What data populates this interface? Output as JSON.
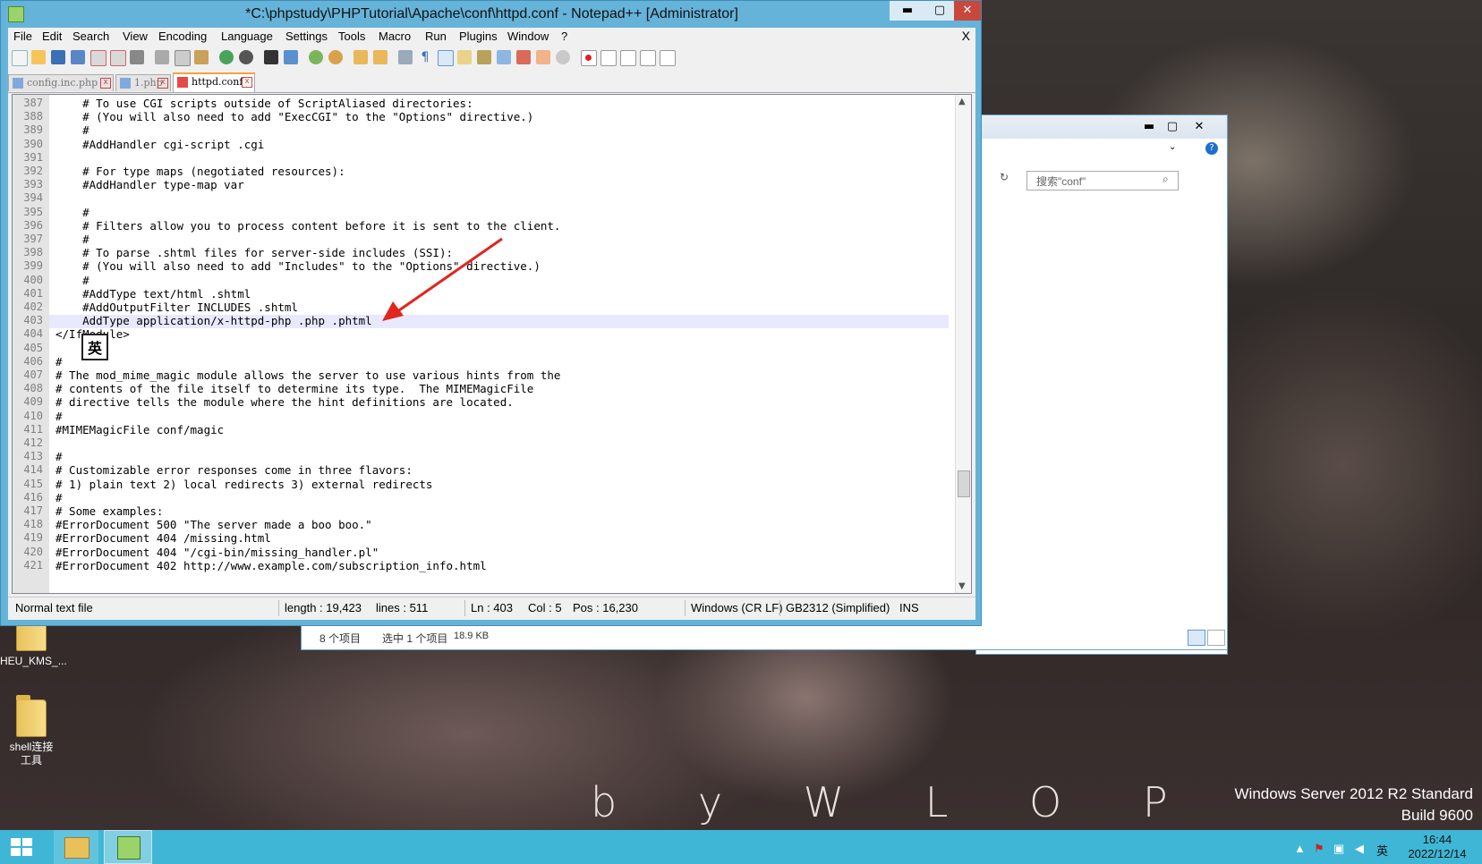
{
  "desktop": {
    "wallpaper_signature": "b y   W L O P",
    "os_version_line1": "Windows Server 2012 R2 Standard",
    "os_version_line2": "Build 9600",
    "icons": [
      {
        "label": "HEU_KMS_..."
      },
      {
        "label": "shell连接工具"
      }
    ]
  },
  "taskbar": {
    "tray_ime": "英",
    "clock_time": "16:44",
    "clock_date": "2022/12/14"
  },
  "explorer": {
    "search_placeholder": "搜索\"conf\"",
    "status_items": "8 个项目",
    "status_selected": "选中 1 个项目",
    "status_size": "18.9 KB"
  },
  "notepad": {
    "title": "*C:\\phpstudy\\PHPTutorial\\Apache\\conf\\httpd.conf - Notepad++ [Administrator]",
    "window_controls": {
      "minimize": "▬",
      "maximize": "▢",
      "close": "✕"
    },
    "menu": [
      "File",
      "Edit",
      "Search",
      "View",
      "Encoding",
      "Language",
      "Settings",
      "Tools",
      "Macro",
      "Run",
      "Plugins",
      "Window",
      "?"
    ],
    "close_doc": "X",
    "tabs": [
      {
        "label": "config.inc.php",
        "active": false
      },
      {
        "label": "1.php",
        "active": false
      },
      {
        "label": "httpd.conf",
        "active": true
      }
    ],
    "lines": [
      {
        "n": "387",
        "text": "    # To use CGI scripts outside of ScriptAliased directories:"
      },
      {
        "n": "388",
        "text": "    # (You will also need to add \"ExecCGI\" to the \"Options\" directive.)"
      },
      {
        "n": "389",
        "text": "    #"
      },
      {
        "n": "390",
        "text": "    #AddHandler cgi-script .cgi"
      },
      {
        "n": "391",
        "text": ""
      },
      {
        "n": "392",
        "text": "    # For type maps (negotiated resources):"
      },
      {
        "n": "393",
        "text": "    #AddHandler type-map var"
      },
      {
        "n": "394",
        "text": ""
      },
      {
        "n": "395",
        "text": "    #"
      },
      {
        "n": "396",
        "text": "    # Filters allow you to process content before it is sent to the client."
      },
      {
        "n": "397",
        "text": "    #"
      },
      {
        "n": "398",
        "text": "    # To parse .shtml files for server-side includes (SSI):"
      },
      {
        "n": "399",
        "text": "    # (You will also need to add \"Includes\" to the \"Options\" directive.)"
      },
      {
        "n": "400",
        "text": "    #"
      },
      {
        "n": "401",
        "text": "    #AddType text/html .shtml"
      },
      {
        "n": "402",
        "text": "    #AddOutputFilter INCLUDES .shtml"
      },
      {
        "n": "403",
        "text": "    AddType application/x-httpd-php .php .phtml"
      },
      {
        "n": "404",
        "text": "</IfModule>"
      },
      {
        "n": "405",
        "text": ""
      },
      {
        "n": "406",
        "text": "#"
      },
      {
        "n": "407",
        "text": "# The mod_mime_magic module allows the server to use various hints from the"
      },
      {
        "n": "408",
        "text": "# contents of the file itself to determine its type.  The MIMEMagicFile"
      },
      {
        "n": "409",
        "text": "# directive tells the module where the hint definitions are located."
      },
      {
        "n": "410",
        "text": "#"
      },
      {
        "n": "411",
        "text": "#MIMEMagicFile conf/magic"
      },
      {
        "n": "412",
        "text": ""
      },
      {
        "n": "413",
        "text": "#"
      },
      {
        "n": "414",
        "text": "# Customizable error responses come in three flavors:"
      },
      {
        "n": "415",
        "text": "# 1) plain text 2) local redirects 3) external redirects"
      },
      {
        "n": "416",
        "text": "#"
      },
      {
        "n": "417",
        "text": "# Some examples:"
      },
      {
        "n": "418",
        "text": "#ErrorDocument 500 \"The server made a boo boo.\""
      },
      {
        "n": "419",
        "text": "#ErrorDocument 404 /missing.html"
      },
      {
        "n": "420",
        "text": "#ErrorDocument 404 \"/cgi-bin/missing_handler.pl\""
      },
      {
        "n": "421",
        "text": "#ErrorDocument 402 http://www.example.com/subscription_info.html"
      }
    ],
    "ime_indicator": "英",
    "status": {
      "file_type": "Normal text file",
      "length": "length : 19,423",
      "lines": "lines : 511",
      "ln": "Ln : 403",
      "col": "Col : 5",
      "pos": "Pos : 16,230",
      "eol": "Windows (CR LF)",
      "encoding": "GB2312 (Simplified)",
      "mode": "INS"
    },
    "colors": {
      "title_bar": "#65b3d9",
      "close": "#c7483d",
      "current_line": "#e8e8ff",
      "annotation_arrow": "#e0261f"
    }
  }
}
